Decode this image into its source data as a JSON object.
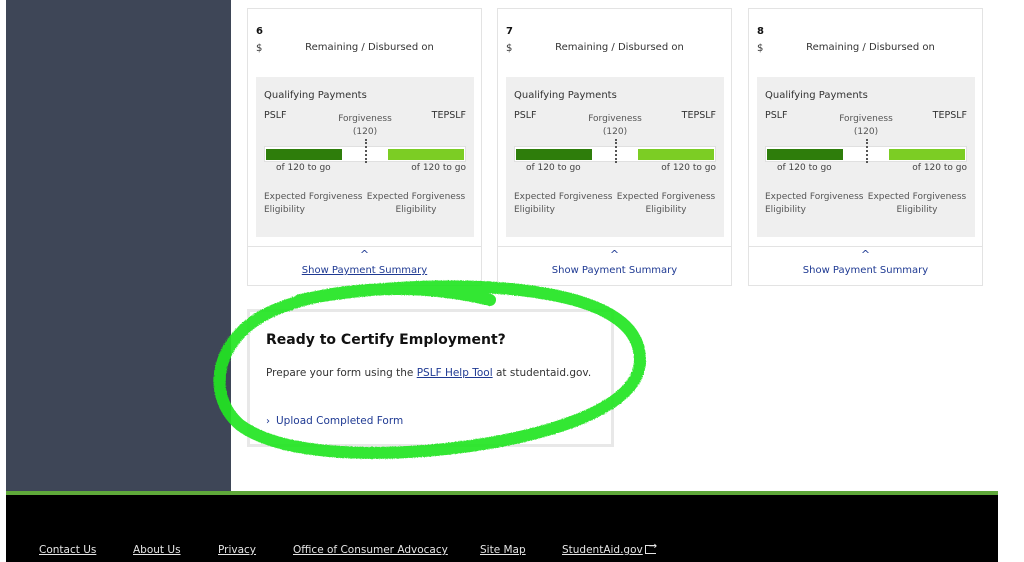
{
  "cards": [
    {
      "number": "6",
      "currency": "$",
      "status_text": "Remaining / Disbursed on",
      "panel_title": "Qualifying Payments",
      "left_label": "PSLF",
      "right_label": "TEPSLF",
      "center_label": "Forgiveness",
      "center_value": "(120)",
      "left_progress_fraction": 0.38,
      "right_progress_fraction": 0.38,
      "left_togo": "of 120 to go",
      "right_togo": "of 120 to go",
      "left_eligibility": "Expected Forgiveness Eligibility",
      "right_eligibility": "Expected Forgiveness Eligibility",
      "caret_icon": "chevron-up-icon",
      "summary_link": "Show Payment Summary"
    },
    {
      "number": "7",
      "currency": "$",
      "status_text": "Remaining / Disbursed on",
      "panel_title": "Qualifying Payments",
      "left_label": "PSLF",
      "right_label": "TEPSLF",
      "center_label": "Forgiveness",
      "center_value": "(120)",
      "left_progress_fraction": 0.38,
      "right_progress_fraction": 0.38,
      "left_togo": "of 120 to go",
      "right_togo": "of 120 to go",
      "left_eligibility": "Expected Forgiveness Eligibility",
      "right_eligibility": "Expected Forgiveness Eligibility",
      "caret_icon": "chevron-up-icon",
      "summary_link": "Show Payment Summary"
    },
    {
      "number": "8",
      "currency": "$",
      "status_text": "Remaining / Disbursed on",
      "panel_title": "Qualifying Payments",
      "left_label": "PSLF",
      "right_label": "TEPSLF",
      "center_label": "Forgiveness",
      "center_value": "(120)",
      "left_progress_fraction": 0.38,
      "right_progress_fraction": 0.38,
      "left_togo": "of 120 to go",
      "right_togo": "of 120 to go",
      "left_eligibility": "Expected Forgiveness Eligibility",
      "right_eligibility": "Expected Forgiveness Eligibility",
      "caret_icon": "chevron-up-icon",
      "summary_link": "Show Payment Summary"
    }
  ],
  "certify": {
    "title": "Ready to Certify Employment?",
    "desc_before": "Prepare your form using the ",
    "desc_link": "PSLF Help Tool",
    "desc_after": " at studentaid.gov.",
    "upload_chevron": "›",
    "upload_link": "Upload Completed Form"
  },
  "annotation": {
    "type": "hand-drawn-circle",
    "color": "#22e522"
  },
  "footer": {
    "links": [
      "Contact Us",
      "About Us",
      "Privacy",
      "Office of Consumer Advocacy",
      "Site Map",
      "StudentAid.gov"
    ],
    "external_icon": "external-link-icon"
  },
  "colors": {
    "sidebar": "#3e4657",
    "pslf_bar": "#2e7d0b",
    "tepslf_bar": "#7ccd24",
    "link": "#1f3a93",
    "footer_bg": "#000000",
    "footer_accent": "#5fa83a"
  }
}
